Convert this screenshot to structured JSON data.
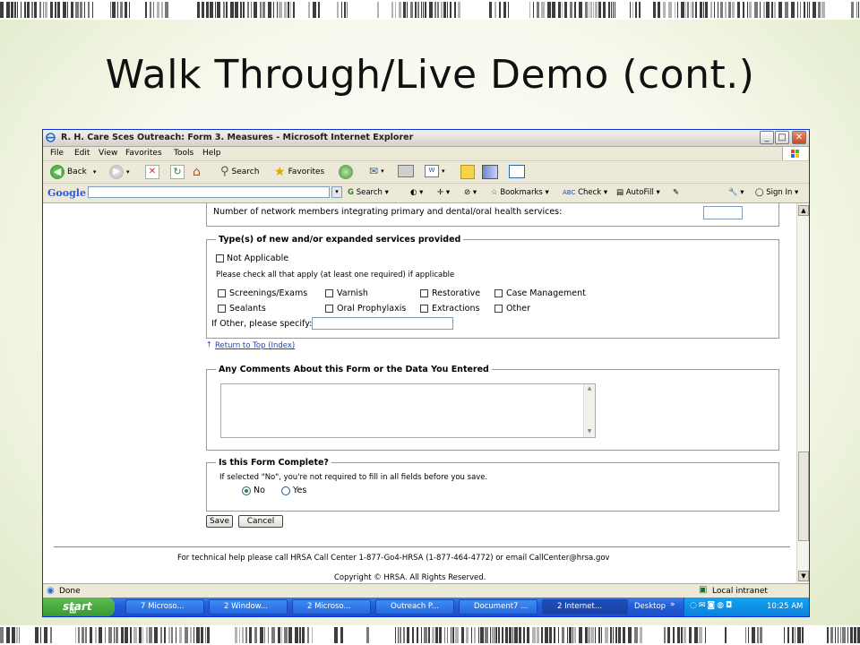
{
  "slide": {
    "title": "Walk Through/Live Demo (cont.)"
  },
  "window": {
    "title": "R. H. Care Sces Outreach: Form 3. Measures - Microsoft Internet Explorer"
  },
  "menu": [
    "File",
    "Edit",
    "View",
    "Favorites",
    "Tools",
    "Help"
  ],
  "toolbar": {
    "back": "Back",
    "search": "Search",
    "favorites": "Favorites"
  },
  "googlebar": {
    "logo": "Google",
    "search": "Search",
    "bookmarks": "Bookmarks",
    "check": "Check",
    "autofill": "AutoFill",
    "signin": "Sign In"
  },
  "form": {
    "network_text": "Number of network members integrating primary and dental/oral health services:",
    "services": {
      "legend": "Type(s) of new and/or expanded services provided",
      "not_applicable": "Not Applicable",
      "instruction": "Please check all that apply (at least one required) if applicable",
      "options": [
        "Screenings/Exams",
        "Varnish",
        "Restorative",
        "Case Management",
        "Sealants",
        "Oral Prophylaxis",
        "Extractions",
        "Other"
      ],
      "other_label": "If Other, please specify:"
    },
    "return_link": "Return to Top (Index)",
    "comments": {
      "legend": "Any Comments About this Form or the Data You Entered"
    },
    "complete": {
      "legend": "Is this Form Complete?",
      "note": "If selected \"No\", you're not required to fill in all fields before you save.",
      "no": "No",
      "yes": "Yes",
      "selected": "No"
    },
    "save": "Save",
    "cancel": "Cancel",
    "footer_help": "For technical help please call HRSA Call Center 1-877-Go4-HRSA (1-877-464-4772) or email CallCenter@hrsa.gov",
    "copyright": "Copyright © HRSA. All Rights Reserved."
  },
  "status": {
    "left": "Done",
    "zone": "Local intranet"
  },
  "taskbar": {
    "start": "start",
    "tasks": [
      "7 Microso...",
      "2 Window...",
      "2 Microso...",
      "Outreach P...",
      "Document7 ...",
      "2 Internet..."
    ],
    "desktop": "Desktop",
    "clock": "10:25 AM"
  },
  "colors": {
    "link": "#2244bb",
    "taskbar": "#245edb",
    "start": "#3a9a32"
  }
}
